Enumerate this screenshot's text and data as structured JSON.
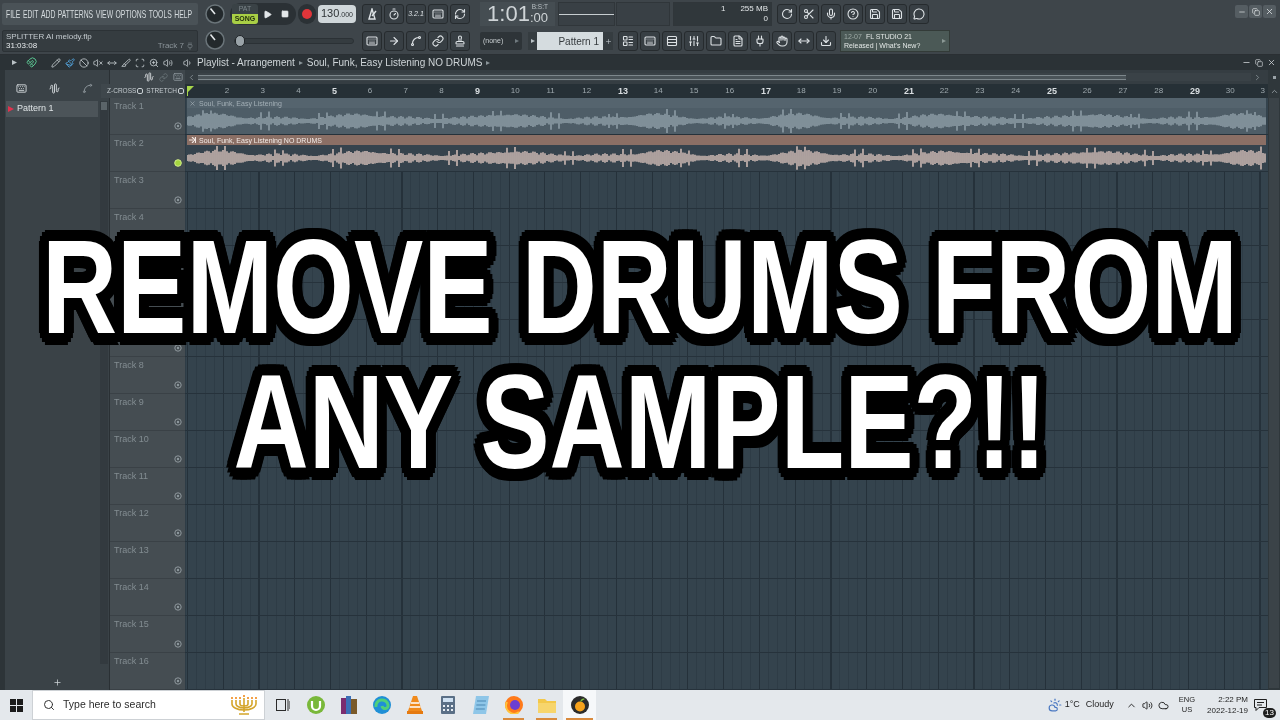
{
  "menu": [
    "FILE",
    "EDIT",
    "ADD",
    "PATTERNS",
    "VIEW",
    "OPTIONS",
    "TOOLS",
    "HELP"
  ],
  "hint_panel": {
    "file": "SPLITTER AI melody.flp",
    "time": "31:03:08",
    "track": "Track 7"
  },
  "modes": [
    {
      "label": "PAT",
      "selected": false
    },
    {
      "label": "SONG",
      "selected": true
    }
  ],
  "tempo": {
    "whole": "130",
    "fraction": ".000"
  },
  "song_position": {
    "level": 0
  },
  "countdown": "3.2.1",
  "time": {
    "main": "1:01",
    "ticks": ":00",
    "format": "B:S:T"
  },
  "performance": {
    "cpu": "1",
    "memory": "255 MB",
    "polyphony": "0"
  },
  "channel_selector": "(none)",
  "pattern_selector": "Pattern 1",
  "news": {
    "date": "12-07",
    "title": "FL STUDIO 21",
    "text": "Released | What's New?"
  },
  "playlist": {
    "title": "Playlist - Arrangement",
    "breadcrumb": "Soul, Funk, Easy Listening NO DRUMS",
    "toggles": [
      {
        "label": "Z-CROSS",
        "checked": false
      },
      {
        "label": "STRETCH",
        "checked": false
      }
    ],
    "picker": [
      {
        "label": "Pattern 1",
        "selected": true
      }
    ],
    "ruler": [
      {
        "label": "2",
        "major": false
      },
      {
        "label": "3",
        "major": false
      },
      {
        "label": "4",
        "major": false
      },
      {
        "label": "5",
        "major": true
      },
      {
        "label": "6",
        "major": false
      },
      {
        "label": "7",
        "major": false
      },
      {
        "label": "8",
        "major": false
      },
      {
        "label": "9",
        "major": true
      },
      {
        "label": "10",
        "major": false
      },
      {
        "label": "11",
        "major": false
      },
      {
        "label": "12",
        "major": false
      },
      {
        "label": "13",
        "major": true
      },
      {
        "label": "14",
        "major": false
      },
      {
        "label": "15",
        "major": false
      },
      {
        "label": "16",
        "major": false
      },
      {
        "label": "17",
        "major": true
      },
      {
        "label": "18",
        "major": false
      },
      {
        "label": "19",
        "major": false
      },
      {
        "label": "20",
        "major": false
      },
      {
        "label": "21",
        "major": true
      },
      {
        "label": "22",
        "major": false
      },
      {
        "label": "23",
        "major": false
      },
      {
        "label": "24",
        "major": false
      },
      {
        "label": "25",
        "major": true
      },
      {
        "label": "26",
        "major": false
      },
      {
        "label": "27",
        "major": false
      },
      {
        "label": "28",
        "major": false
      },
      {
        "label": "29",
        "major": true
      },
      {
        "label": "30",
        "major": false
      },
      {
        "label": "3",
        "major": false
      }
    ],
    "tracks": [
      {
        "name": "Track 1",
        "active": false,
        "clip": {
          "title": "Soul, Funk, Easy Listening",
          "muted": true
        }
      },
      {
        "name": "Track 2",
        "active": true,
        "clip": {
          "title": "Soul, Funk, Easy Listening NO DRUMS",
          "muted": false,
          "color": "#8b6f65"
        }
      },
      {
        "name": "Track 3",
        "active": false
      },
      {
        "name": "Track 4"
      }
    ],
    "lower_tracks": [
      {
        "active": false
      },
      {
        "name": "Track 8",
        "active": false
      },
      {
        "name": "Track 9",
        "active": false
      },
      {
        "name": "Track 10",
        "active": false
      },
      {
        "name": "Track 11",
        "active": false
      },
      {
        "name": "Track 12",
        "active": false
      },
      {
        "name": "Track 13",
        "active": false
      },
      {
        "name": "Track 14",
        "active": false
      },
      {
        "name": "Track 15",
        "active": false
      },
      {
        "name": "Track 16",
        "active": false
      }
    ]
  },
  "overlay": {
    "lines": [
      "REMOVE DRUMS FROM",
      "ANY SAMPLE?!!"
    ]
  },
  "taskbar": {
    "search": {
      "placeholder": "Type here to search"
    },
    "apps": [
      {
        "kind": "torrent",
        "running": false,
        "active": false
      },
      {
        "kind": "books",
        "running": false,
        "active": false
      },
      {
        "kind": "swirl",
        "running": false,
        "active": false
      },
      {
        "kind": "cone",
        "running": false,
        "active": false
      },
      {
        "kind": "calculator",
        "running": false,
        "active": false
      },
      {
        "kind": "notes",
        "running": false,
        "active": false
      },
      {
        "kind": "fox",
        "running": true,
        "active": false
      },
      {
        "kind": "folder",
        "running": true,
        "active": false
      },
      {
        "kind": "fruit",
        "running": true,
        "active": true
      }
    ],
    "weather": {
      "temperature": "1°C",
      "condition": "Cloudy"
    },
    "language": {
      "code": "ENG",
      "region": "US"
    },
    "clock": {
      "time": "2:22 PM",
      "date": "2022-12-19"
    },
    "notifications": "13"
  }
}
